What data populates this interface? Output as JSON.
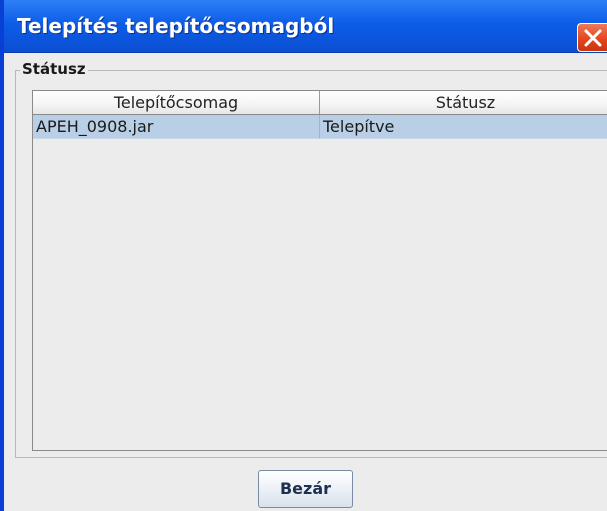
{
  "window": {
    "title": "Telepítés telepítőcsomagból"
  },
  "group": {
    "title": "Státusz"
  },
  "table": {
    "columns": [
      "Telepítőcsomag",
      "Státusz"
    ],
    "rows": [
      [
        "APEH_0908.jar",
        "Telepítve"
      ]
    ]
  },
  "footer": {
    "close_label": "Bezár"
  },
  "icons": {
    "title_close": "close-icon"
  },
  "colors": {
    "titlebar": "#0d5de8",
    "close_button": "#e3471d",
    "selected_row": "#b8cfe5"
  }
}
